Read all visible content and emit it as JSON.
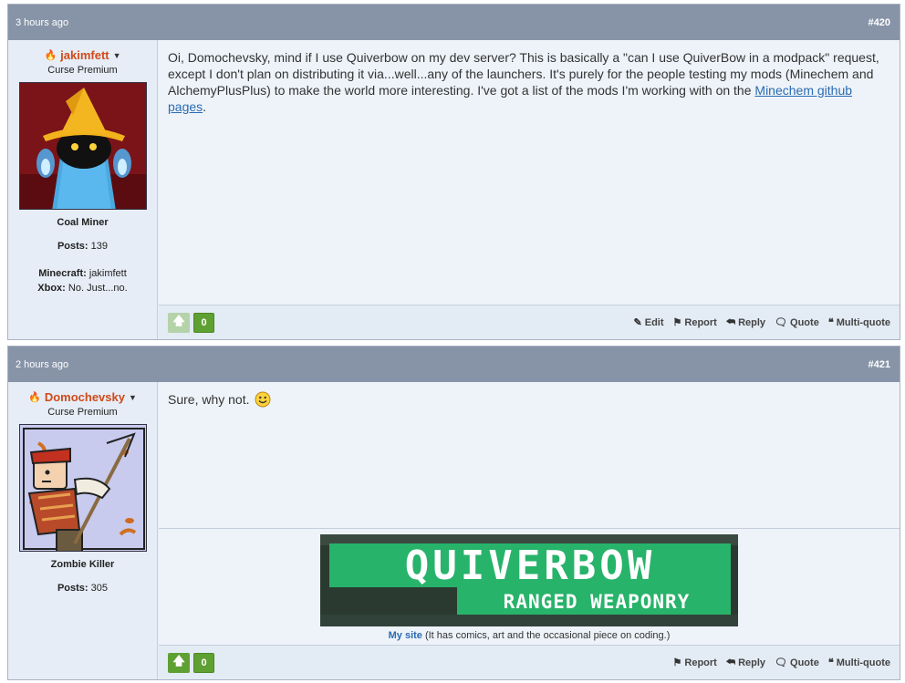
{
  "posts": [
    {
      "time": "3 hours ago",
      "number": "#420",
      "username": "jakimfett",
      "user_title": "Curse Premium",
      "rank": "Coal Miner",
      "posts_label": "Posts:",
      "posts_count": "139",
      "minecraft_label": "Minecraft:",
      "minecraft_value": "jakimfett",
      "xbox_label": "Xbox:",
      "xbox_value": "No. Just...no.",
      "message_text": "Oi, Domochevsky, mind if I use Quiverbow on my dev server? This is basically a \"can I use QuiverBow in a modpack\" request, except I don't plan on distributing it via...well...any of the launchers. It's purely for the people testing my mods (Minechem and AlchemyPlusPlus) to make the world more interesting. I've got a list of the mods I'm working with on the ",
      "message_link": "Minechem github pages",
      "message_end": ".",
      "vote_count": "0",
      "actions": {
        "edit": "Edit",
        "report": "Report",
        "reply": "Reply",
        "quote": "Quote",
        "multiquote": "Multi-quote"
      }
    },
    {
      "time": "2 hours ago",
      "number": "#421",
      "username": "Domochevsky",
      "user_title": "Curse Premium",
      "rank": "Zombie Killer",
      "posts_label": "Posts:",
      "posts_count": "305",
      "message_text": "Sure, why not.",
      "banner_title": "QUIVERBOW",
      "banner_subtitle": "RANGED WEAPONRY",
      "sig_link": "My site",
      "sig_text": " (It has comics, art and the occasional piece on coding.)",
      "vote_count": "0",
      "actions": {
        "report": "Report",
        "reply": "Reply",
        "quote": "Quote",
        "multiquote": "Multi-quote"
      }
    }
  ],
  "icons": {
    "flame": "flame-icon",
    "caret": "caret-down-icon",
    "upvote": "arrow-up-icon",
    "edit": "pencil-icon",
    "report": "flag-icon",
    "reply": "reply-arrow-icon",
    "quote": "speech-bubble-icon",
    "multiquote": "multi-quote-icon",
    "smiley": "smiley-icon"
  },
  "colors": {
    "header": "#8794a8",
    "username": "#d04a1a",
    "vote_green": "#5fa032",
    "link": "#2a6bb0"
  }
}
